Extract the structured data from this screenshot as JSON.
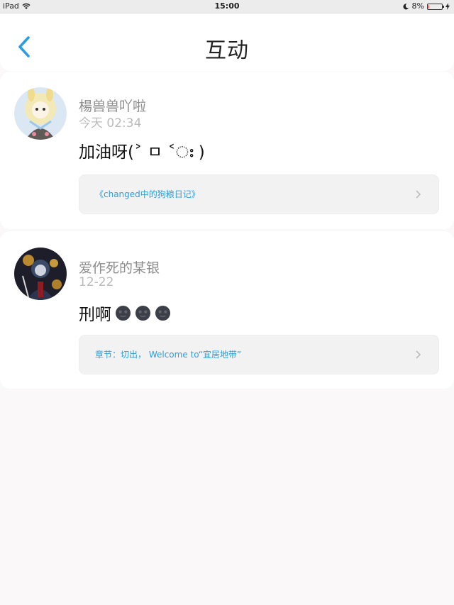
{
  "status": {
    "device": "iPad",
    "time": "15:00",
    "battery": "8%",
    "battery_level": 0.08,
    "battery_color": "#e53935"
  },
  "nav": {
    "title": "互动",
    "back_icon": "chevron-left-icon",
    "accent": "#2a9ee0"
  },
  "comments": [
    {
      "user": "楊兽兽吖啦",
      "time": "今天 02:34",
      "text": "加油呀(˃ ㅁ ˂ഃ )",
      "link": "《changed中的狗粮日记》"
    },
    {
      "user": "爱作死的某银",
      "time": "12-22",
      "text": "刑啊",
      "emojis": [
        "new-moon-face-icon",
        "new-moon-face-icon",
        "new-moon-face-icon"
      ],
      "link": "章节：切出， Welcome to“宜居地带”"
    }
  ]
}
